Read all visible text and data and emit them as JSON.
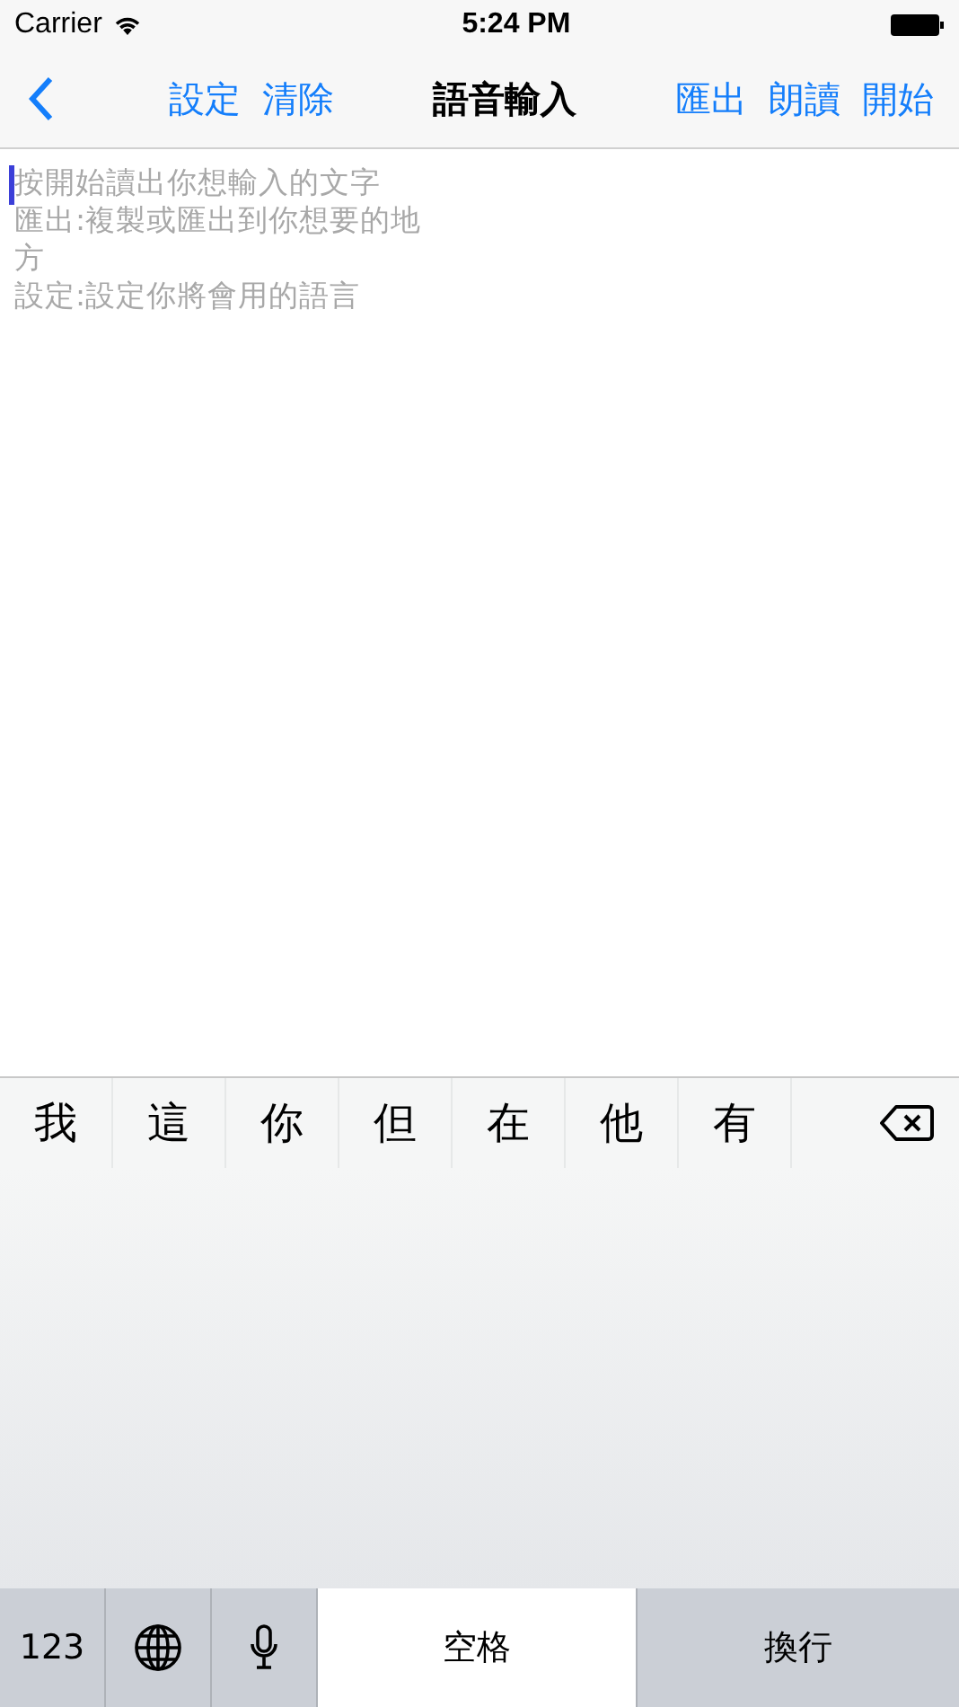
{
  "status_bar": {
    "carrier": "Carrier",
    "time": "5:24 PM"
  },
  "nav": {
    "left_buttons": [
      "設定",
      "清除"
    ],
    "title": "語音輸入",
    "right_buttons": [
      "匯出",
      "朗讀",
      "開始"
    ]
  },
  "editor": {
    "placeholder_lines": [
      "按開始讀出你想輸入的文字",
      "匯出:複製或匯出到你想要的地方",
      "設定:設定你將會用的語言"
    ]
  },
  "candidates": [
    "我",
    "這",
    "你",
    "但",
    "在",
    "他",
    "有"
  ],
  "keyboard": {
    "keys": [
      {
        "kind": "text",
        "label": "123"
      },
      {
        "kind": "globe"
      },
      {
        "kind": "mic"
      },
      {
        "kind": "space",
        "label": "空格"
      },
      {
        "kind": "return",
        "label": "換行"
      }
    ]
  }
}
